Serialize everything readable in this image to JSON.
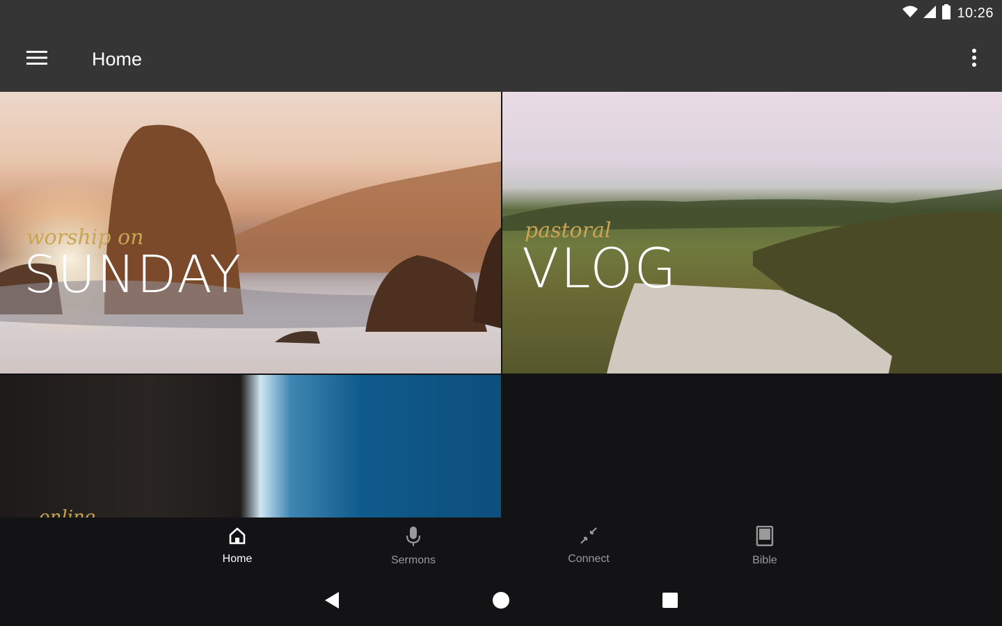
{
  "status_bar": {
    "time": "10:26"
  },
  "app_bar": {
    "title": "Home"
  },
  "tiles": [
    {
      "subtitle": "worship on",
      "title": "SUNDAY"
    },
    {
      "subtitle": "pastoral",
      "title": "VLOG"
    },
    {
      "subtitle": "online"
    }
  ],
  "bottom_nav": {
    "items": [
      {
        "label": "Home",
        "icon": "home-icon",
        "active": true
      },
      {
        "label": "Sermons",
        "icon": "microphone-icon",
        "active": false
      },
      {
        "label": "Connect",
        "icon": "connect-icon",
        "active": false
      },
      {
        "label": "Bible",
        "icon": "book-icon",
        "active": false
      }
    ]
  },
  "colors": {
    "app_bar": "#353535",
    "background": "#131315",
    "accent_gold": "#c9a553",
    "inactive": "#9a9a9a"
  }
}
